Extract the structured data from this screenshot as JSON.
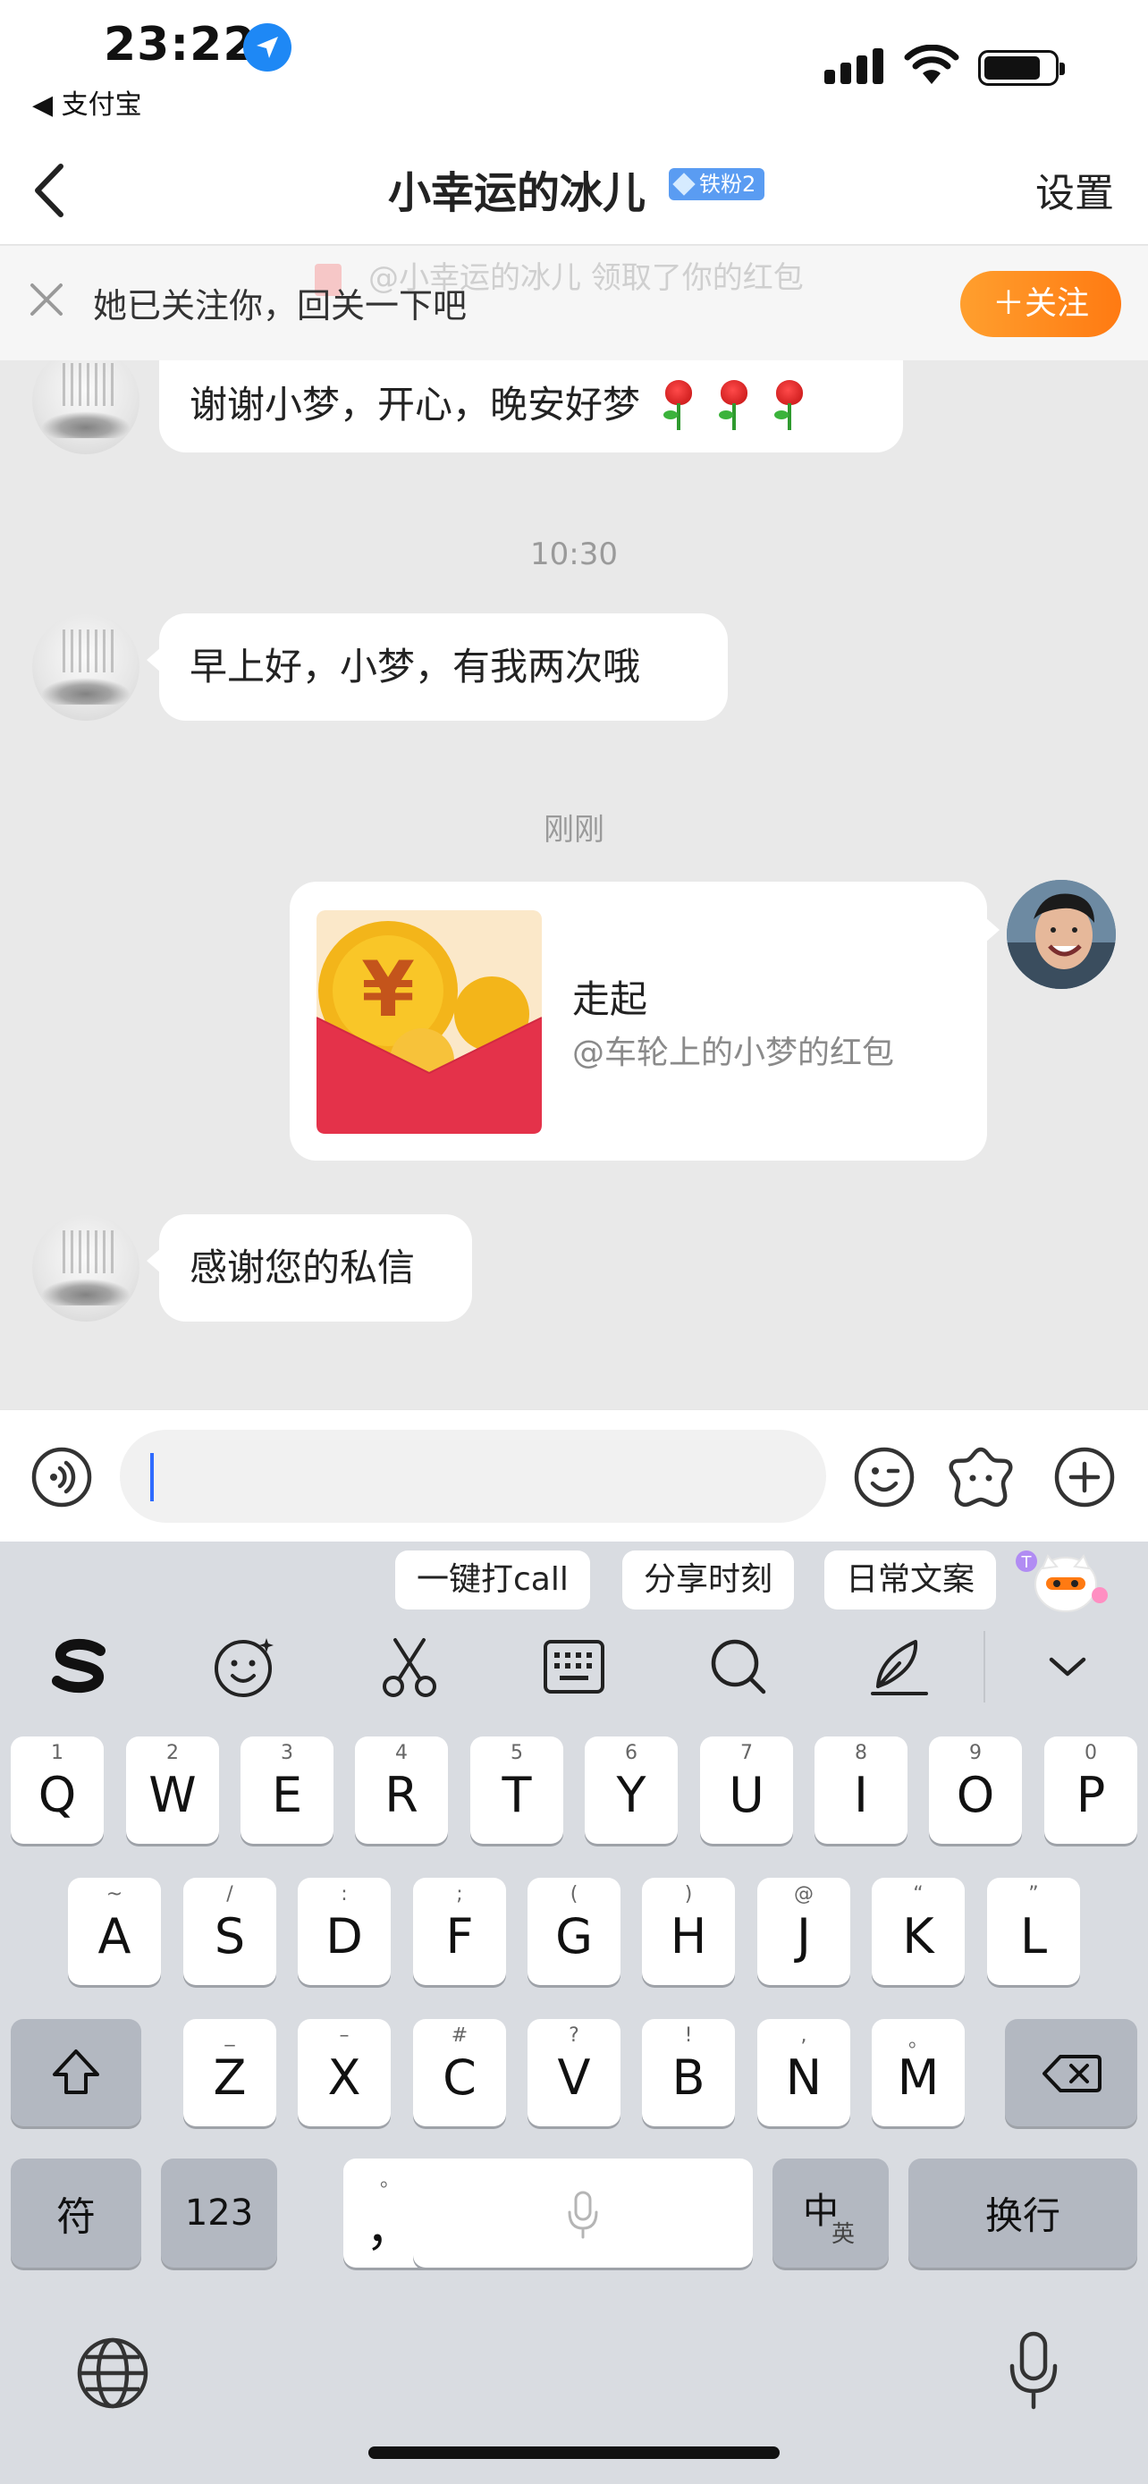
{
  "status_bar": {
    "time": "23:22",
    "back_app": "◀ 支付宝"
  },
  "nav": {
    "title": "小幸运的冰儿",
    "fan_badge": "铁粉2",
    "settings_label": "设置"
  },
  "banner": {
    "ghost_notice": "@小幸运的冰儿 领取了你的红包",
    "text": "她已关注你，回关一下吧",
    "follow_label": "＋关注"
  },
  "messages": [
    {
      "from": "other",
      "text": "谢谢小梦，开心，晚安好梦"
    },
    {
      "timestamp": "10:30"
    },
    {
      "from": "other",
      "text": "早上好，小梦，有我两次哦"
    },
    {
      "timestamp": "刚刚"
    },
    {
      "from": "self",
      "type": "red-packet",
      "title": "走起",
      "subtitle": "@车轮上的小梦的红包"
    },
    {
      "from": "other",
      "text": "感谢您的私信"
    }
  ],
  "input": {
    "placeholder": ""
  },
  "keyboard": {
    "suggestions": [
      "一键打call",
      "分享时刻",
      "日常文案"
    ],
    "row1": [
      {
        "hint": "1",
        "key": "Q"
      },
      {
        "hint": "2",
        "key": "W"
      },
      {
        "hint": "3",
        "key": "E"
      },
      {
        "hint": "4",
        "key": "R"
      },
      {
        "hint": "5",
        "key": "T"
      },
      {
        "hint": "6",
        "key": "Y"
      },
      {
        "hint": "7",
        "key": "U"
      },
      {
        "hint": "8",
        "key": "I"
      },
      {
        "hint": "9",
        "key": "O"
      },
      {
        "hint": "0",
        "key": "P"
      }
    ],
    "row2": [
      {
        "hint": "~",
        "key": "A"
      },
      {
        "hint": "/",
        "key": "S"
      },
      {
        "hint": ":",
        "key": "D"
      },
      {
        "hint": ";",
        "key": "F"
      },
      {
        "hint": "(",
        "key": "G"
      },
      {
        "hint": ")",
        "key": "H"
      },
      {
        "hint": "@",
        "key": "J"
      },
      {
        "hint": "“",
        "key": "K"
      },
      {
        "hint": "”",
        "key": "L"
      }
    ],
    "row3": [
      {
        "hint": "_",
        "key": "Z"
      },
      {
        "hint": "–",
        "key": "X"
      },
      {
        "hint": "#",
        "key": "C"
      },
      {
        "hint": "?",
        "key": "V"
      },
      {
        "hint": "!",
        "key": "B"
      },
      {
        "hint": ",",
        "key": "N"
      },
      {
        "hint": "。",
        "key": "M"
      }
    ],
    "symbols_label": "符",
    "numbers_label": "123",
    "punct_label": "，",
    "punct_hint": "。",
    "lang_main": "中",
    "lang_sub": "英",
    "return_label": "换行"
  }
}
